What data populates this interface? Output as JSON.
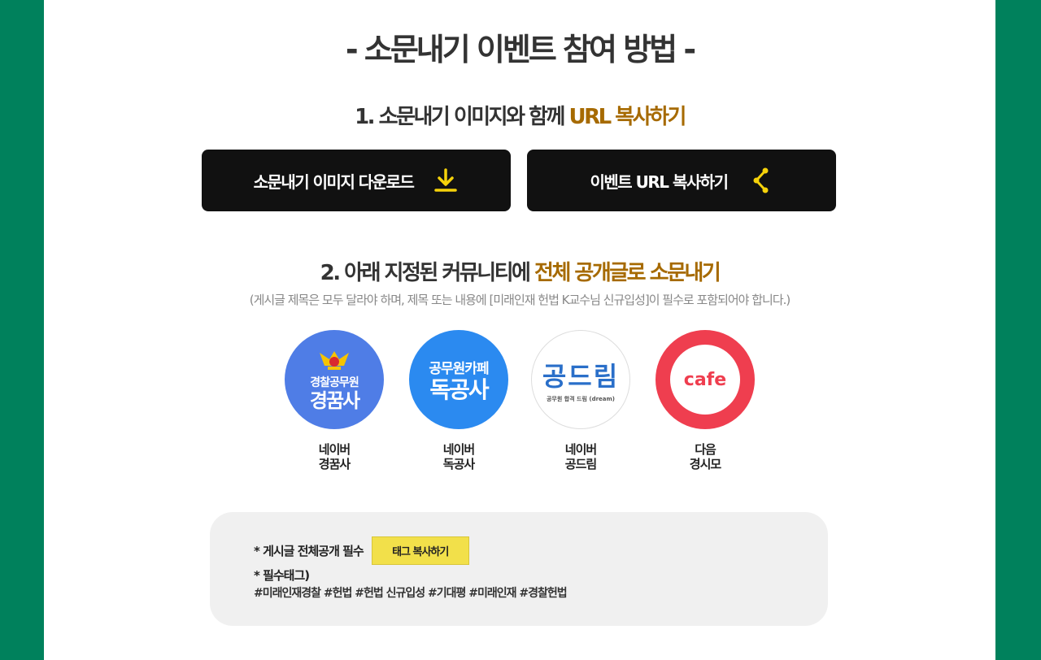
{
  "title": "- 소문내기 이벤트 참여 방법 -",
  "step1": {
    "title_plain": "1. 소문내기 이미지와 함께 ",
    "title_accent": "URL 복사하기"
  },
  "buttons": {
    "download_label": "소문내기 이미지 다운로드",
    "share_label": "이벤트 URL 복사하기"
  },
  "step2": {
    "title_plain": "2. 아래 지정된 커뮤니티에 ",
    "title_accent": "전체 공개글로 소문내기",
    "note": "(게시글 제목은 모두 달라야 하며, 제목 또는 내용에  [미래인재 헌법 K교수님 신규입성]이 필수로 포함되어야 합니다.)"
  },
  "communities": [
    {
      "logo_line1": "경찰공무원",
      "logo_line2": "경꿈사",
      "platform": "네이버",
      "name": "경꿈사"
    },
    {
      "logo_line1": "공무원카페",
      "logo_line2": "독공사",
      "platform": "네이버",
      "name": "독공사"
    },
    {
      "logo_line1": "공드림",
      "logo_line2": "공무원 합격 드림 (dream)",
      "platform": "네이버",
      "name": "공드림"
    },
    {
      "logo_line1": "cafe",
      "platform": "다음",
      "name": "경시모"
    }
  ],
  "tags": {
    "required_label": "* 게시글 전체공개 필수",
    "copy_button": "태그 복사하기",
    "required_tags_label": "* 필수태그)",
    "tag_list": "#미래인재경찰 #헌법 #헌법 신규입성 #기대평 #미래인재 #경찰헌법"
  },
  "colors": {
    "background": "#00815c",
    "accent": "#a66a00",
    "button": "#111111",
    "icon_yellow": "#f5d20a",
    "tag_button": "#f2e04a"
  }
}
